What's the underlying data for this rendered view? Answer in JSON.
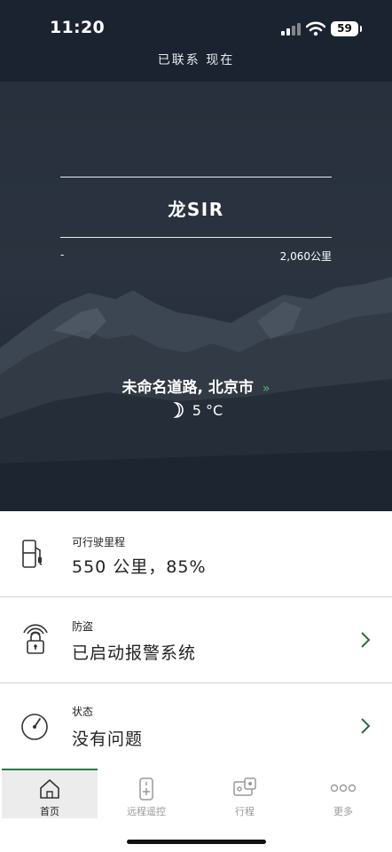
{
  "status_bar": {
    "time": "11:20",
    "battery": "59",
    "connection_status": "已联系 现在"
  },
  "hero": {
    "car_name": "龙SIR",
    "left_value": "-",
    "mileage": "2,060公里",
    "location": "未命名道路, 北京市",
    "location_chevron": "»",
    "temperature": "5 °C",
    "weather_icon": "moon-icon"
  },
  "cards": {
    "range": {
      "label": "可行驶里程",
      "value": "550 公里，85%",
      "icon": "fuel-pump-icon"
    },
    "anti_theft": {
      "label": "防盗",
      "value": "已启动报警系统",
      "icon": "alarm-lock-icon"
    },
    "status": {
      "label": "状态",
      "value": "没有问题",
      "icon": "gauge-icon"
    }
  },
  "tabs": [
    {
      "label": "首页",
      "icon": "home-icon",
      "active": true
    },
    {
      "label": "远程遥控",
      "icon": "remote-control-icon",
      "active": false
    },
    {
      "label": "行程",
      "icon": "trip-icon",
      "active": false
    },
    {
      "label": "更多",
      "icon": "more-icon",
      "active": false
    }
  ],
  "colors": {
    "status_bar_bg": "#1c2330",
    "hero_bg": "#27303c",
    "accent_green": "#2a7a45",
    "location_chevron": "#4fb86d"
  }
}
